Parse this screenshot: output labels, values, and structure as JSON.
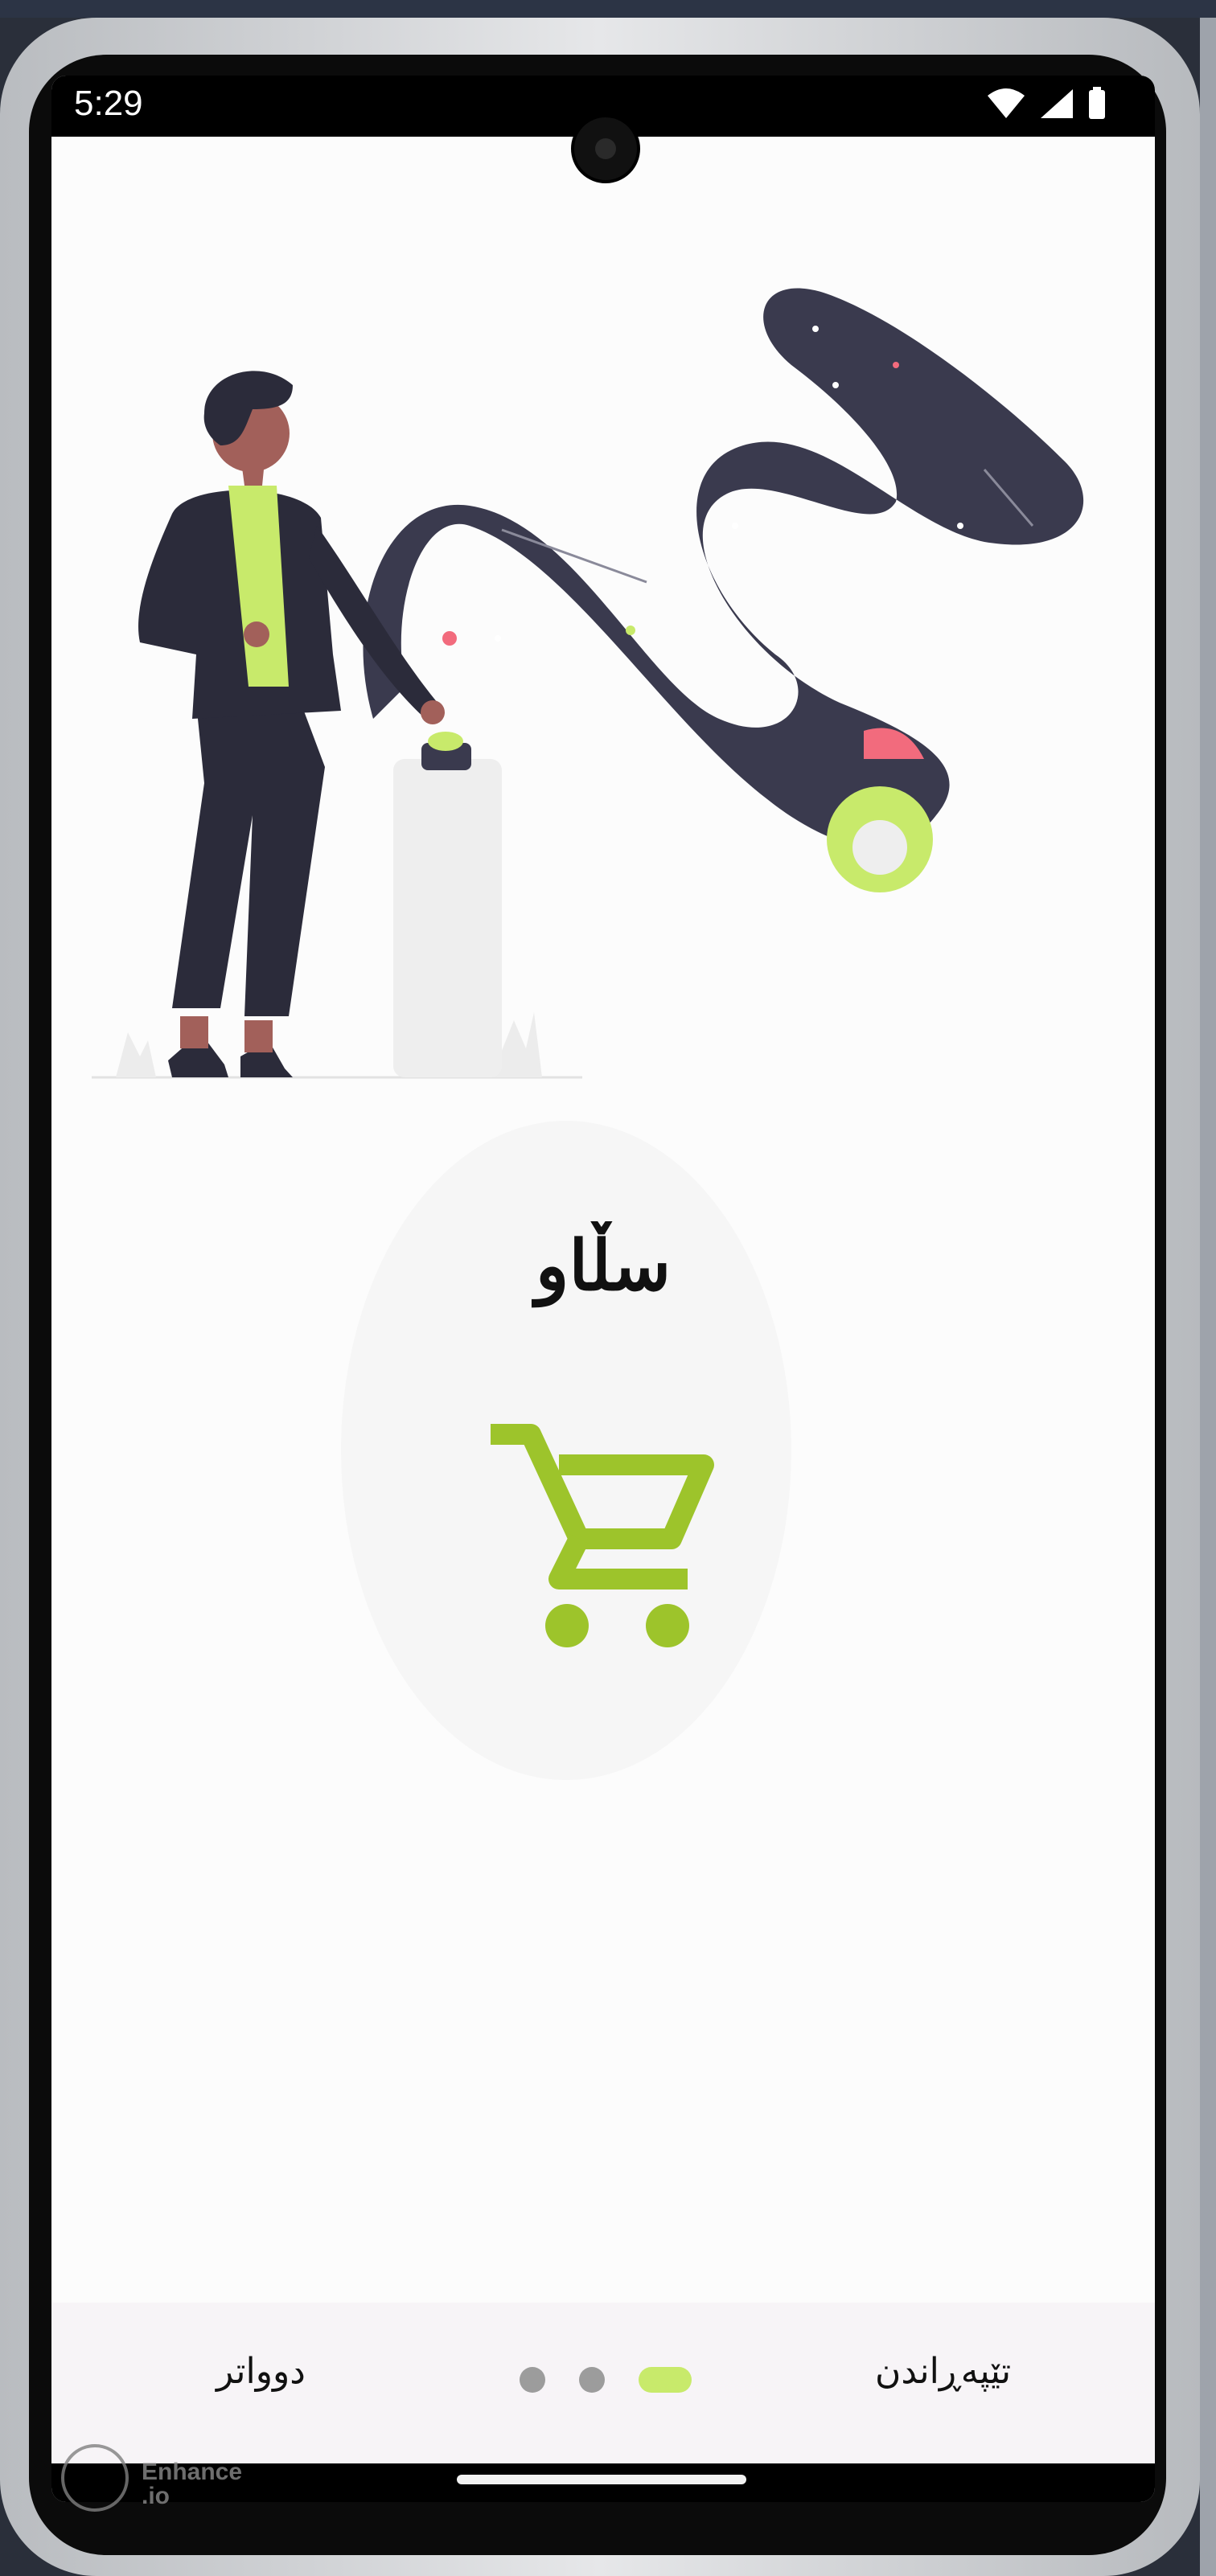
{
  "status_bar": {
    "time": "5:29",
    "icons": [
      "wifi-icon",
      "cell-signal-icon",
      "battery-icon"
    ]
  },
  "onboarding": {
    "title": "سڵاو",
    "center_icon": "shopping-cart-icon",
    "illustration": "person-pressing-button-illustration"
  },
  "bottom_nav": {
    "skip_label": "تێپەڕاندن",
    "next_label": "دوواتر",
    "page_count": 3,
    "active_page": 1
  },
  "colors": {
    "accent": "#c8ea6b",
    "cart": "#9dc42b",
    "dark": "#3a3a4e"
  },
  "watermark": {
    "text": "Enhance .io"
  }
}
